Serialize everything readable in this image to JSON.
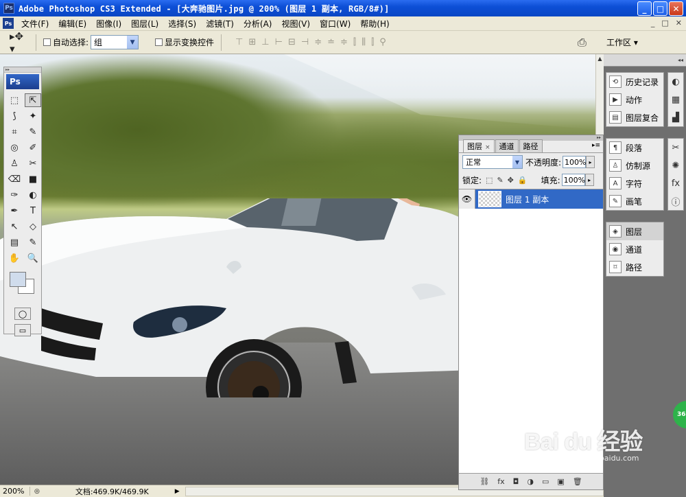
{
  "window": {
    "title": "Adobe Photoshop CS3 Extended - [大奔驰图片.jpg @ 200% (图层 1 副本, RGB/8#)]",
    "app_icon": "Ps",
    "minimize": "_",
    "maximize": "□",
    "close": "✕"
  },
  "menu": {
    "doc_icon": "Ps",
    "items": [
      "文件(F)",
      "编辑(E)",
      "图像(I)",
      "图层(L)",
      "选择(S)",
      "滤镜(T)",
      "分析(A)",
      "视图(V)",
      "窗口(W)",
      "帮助(H)"
    ],
    "mdi_minimize": "_",
    "mdi_restore": "□",
    "mdi_close": "✕"
  },
  "options": {
    "tool_icon": "▸✥ ▾",
    "auto_select_label": "自动选择:",
    "auto_select_value": "组",
    "show_transform_label": "显示变换控件",
    "align_icons": [
      "⊤",
      "⊞",
      "⊥",
      "⊢",
      "⊟",
      "⊣",
      "≑",
      "≐",
      "≑",
      "⫿",
      "⫼",
      "⫿",
      "⚲"
    ],
    "workspace_label": "工作区 ▾"
  },
  "status": {
    "zoom": "200%",
    "doc_info": "文档:469.9K/469.9K",
    "play_icon": "▶"
  },
  "tools": {
    "logo": "Ps",
    "grid": [
      "⬚",
      "⇱",
      "⟆",
      "✦",
      "⌗",
      "✎",
      "◎",
      "✐",
      "♙",
      "✂",
      "⌫",
      "■",
      "✑",
      "◐",
      "✒",
      "T",
      "↖",
      "◇",
      "▤",
      "✎",
      "✋",
      "🔍"
    ]
  },
  "layers_panel": {
    "tabs": [
      "图层",
      "通道",
      "路径"
    ],
    "tab_close": "×",
    "blend_mode": "正常",
    "opacity_label": "不透明度:",
    "opacity_value": "100%",
    "lock_label": "锁定:",
    "fill_label": "填充:",
    "fill_value": "100%",
    "layer_name": "图层 1 副本",
    "footer_icons": [
      "⛓",
      "fx",
      "◘",
      "◑",
      "▭",
      "▣",
      "🗑"
    ]
  },
  "dock": {
    "group1": [
      "历史记录",
      "动作",
      "图层复合"
    ],
    "group2": [
      "段落",
      "仿制源",
      "字符",
      "画笔"
    ],
    "group3": [
      "图层",
      "通道",
      "路径"
    ],
    "badge": "36"
  },
  "watermark": {
    "brand": "Bai du 经验",
    "url": "jingyan.baidu.com"
  }
}
